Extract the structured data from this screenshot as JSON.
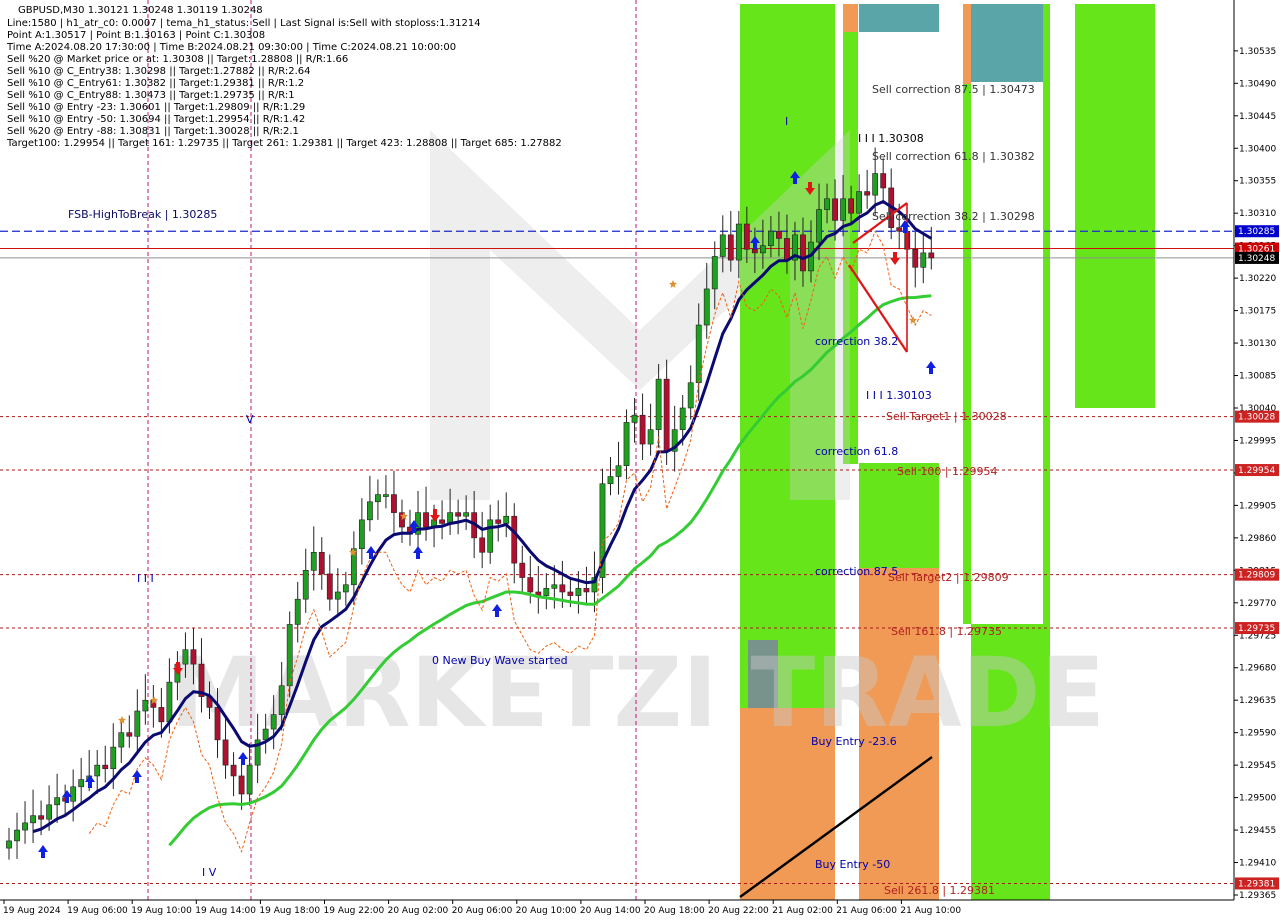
{
  "chart_data": {
    "type": "candlestick",
    "title": "GBPUSD,M30  1.30121 1.30248 1.30119 1.30248",
    "info_lines": [
      "Line:1580 | h1_atr_c0: 0.0007 | tema_h1_status: Sell | Last Signal is:Sell with stoploss:1.31214",
      "Point A:1.30517 | Point B:1.30163 | Point C:1.30308",
      "Time A:2024.08.20 17:30:00 | Time B:2024.08.21 09:30:00 | Time C:2024.08.21 10:00:00",
      "Sell %20 @ Market price or at: 1.30308 || Target:1.28808 || R/R:1.66",
      "Sell %10 @ C_Entry38: 1.30298 || Target:1.27882 || R/R:2.64",
      "Sell %10 @ C_Entry61: 1.30382 || Target:1.29381 || R/R:1.2",
      "Sell %10 @ C_Entry88: 1.30473 || Target:1.29735 || R/R:1",
      "Sell %10 @ Entry -23: 1.30601 || Target:1.29809 || R/R:1.29",
      "Sell %10 @ Entry -50: 1.30694 || Target:1.29954 || R/R:1.42",
      "Sell %20 @ Entry -88: 1.30831 || Target:1.30028 || R/R:2.1",
      "Target100: 1.29954 || Target 161: 1.29735 || Target 261: 1.29381 || Target 423: 1.28808 || Target 685: 1.27882"
    ],
    "ylim": [
      1.29365,
      1.30575
    ],
    "y_ticks": [
      "1.30535",
      "1.30490",
      "1.30445",
      "1.30400",
      "1.30355",
      "1.30310",
      "1.30265",
      "1.30220",
      "1.30175",
      "1.30130",
      "1.30085",
      "1.30040",
      "1.29995",
      "1.29950",
      "1.29905",
      "1.29860",
      "1.29815",
      "1.29770",
      "1.29725",
      "1.29680",
      "1.29635",
      "1.29590",
      "1.29545",
      "1.29500",
      "1.29455",
      "1.29410",
      "1.29365"
    ],
    "x_ticks": [
      "19 Aug 2024",
      "19 Aug 06:00",
      "19 Aug 10:00",
      "19 Aug 14:00",
      "19 Aug 18:00",
      "19 Aug 22:00",
      "20 Aug 02:00",
      "20 Aug 06:00",
      "20 Aug 10:00",
      "20 Aug 14:00",
      "20 Aug 18:00",
      "20 Aug 22:00",
      "21 Aug 02:00",
      "21 Aug 06:00",
      "21 Aug 10:00"
    ],
    "candle_count": 116,
    "closes": [
      1.2944,
      1.29455,
      1.29465,
      1.29475,
      1.2947,
      1.2949,
      1.295,
      1.29495,
      1.29515,
      1.29525,
      1.2953,
      1.29545,
      1.2954,
      1.2957,
      1.2959,
      1.29585,
      1.2962,
      1.29635,
      1.29625,
      1.29605,
      1.2966,
      1.29685,
      1.29705,
      1.29685,
      1.2964,
      1.29625,
      1.2958,
      1.29545,
      1.2953,
      1.29505,
      1.29545,
      1.2958,
      1.29595,
      1.29615,
      1.29655,
      1.2974,
      1.29775,
      1.29815,
      1.2984,
      1.2981,
      1.29775,
      1.29785,
      1.29795,
      1.29845,
      1.29885,
      1.2991,
      1.2992,
      1.2992,
      1.29895,
      1.29875,
      1.29865,
      1.29895,
      1.29875,
      1.29885,
      1.2988,
      1.29895,
      1.2989,
      1.29895,
      1.2986,
      1.2984,
      1.29885,
      1.2988,
      1.2989,
      1.29825,
      1.29805,
      1.29785,
      1.2978,
      1.2979,
      1.29795,
      1.29785,
      1.2978,
      1.2979,
      1.29785,
      1.29805,
      1.29935,
      1.29945,
      1.2996,
      1.3002,
      1.3003,
      1.2999,
      1.3001,
      1.3008,
      1.2998,
      1.3001,
      1.3004,
      1.30075,
      1.30155,
      1.30205,
      1.3025,
      1.3028,
      1.30245,
      1.30295,
      1.3026,
      1.30255,
      1.30265,
      1.30285,
      1.30275,
      1.30245,
      1.3028,
      1.3023,
      1.3027,
      1.30315,
      1.3033,
      1.303,
      1.3033,
      1.3031,
      1.3034,
      1.30335,
      1.30365,
      1.30345,
      1.3029,
      1.30285,
      1.3026,
      1.30235,
      1.30255,
      1.30248
    ],
    "levels": [
      {
        "label": "FSB-HighToBreak | 1.30285",
        "value": 1.30285,
        "badge": "1.30285",
        "badge_color": "#0000cc"
      },
      {
        "label": "",
        "value": 1.30261,
        "badge": "1.30261",
        "badge_color": "#cc0000"
      },
      {
        "label": "",
        "value": 1.30248,
        "badge": "1.30248",
        "badge_color": "#000000"
      },
      {
        "label": "Sell Target1 | 1.30028",
        "value": 1.30028,
        "badge": "1.30028",
        "badge_color": "#cc2222"
      },
      {
        "label": "Sell 100 | 1.29954",
        "value": 1.29954,
        "badge": "1.29954",
        "badge_color": "#cc2222"
      },
      {
        "label": "Sell Target2 | 1.29809",
        "value": 1.29809,
        "badge": "1.29809",
        "badge_color": "#cc2222"
      },
      {
        "label": "Sell 161.8 | 1.29735",
        "value": 1.29735,
        "badge": "1.29735",
        "badge_color": "#cc2222"
      },
      {
        "label": "Sell 261.8 | 1.29381",
        "value": 1.29381,
        "badge": "1.29381",
        "badge_color": "#cc2222"
      }
    ],
    "annotations": [
      {
        "text": "Sell correction 87.5 | 1.30473",
        "color": "#333333"
      },
      {
        "text": "Sell correction 61.8 | 1.30382",
        "color": "#333333"
      },
      {
        "text": "Sell correction 38.2 | 1.30298",
        "color": "#333333"
      },
      {
        "text": "I I I 1.30308",
        "color": "#000000"
      },
      {
        "text": "I I I 1.30103",
        "color": "#0000aa"
      },
      {
        "text": "correction 38.2",
        "color": "#0000aa"
      },
      {
        "text": "correction 61.8",
        "color": "#0000aa"
      },
      {
        "text": "correction 87.5",
        "color": "#0000aa"
      },
      {
        "text": "0 New Buy Wave started",
        "color": "#0000aa"
      },
      {
        "text": "Buy Entry -23.6",
        "color": "#0000aa"
      },
      {
        "text": "Buy Entry -50",
        "color": "#0000aa"
      },
      {
        "text": "I I I",
        "color": "#0000aa"
      },
      {
        "text": "V",
        "color": "#0000aa"
      },
      {
        "text": "I V",
        "color": "#0000aa"
      },
      {
        "text": "I",
        "color": "#0000aa"
      }
    ],
    "watermark": "MARKETZI TRADE",
    "colors": {
      "bull": "#20a020",
      "bear": "#b01030",
      "ma_fast": "#0a0a70",
      "ma_slow": "#33cc33",
      "zone_green": "#66e61a",
      "zone_orange": "#f09a55",
      "zone_teal": "#5aa5a8"
    }
  }
}
